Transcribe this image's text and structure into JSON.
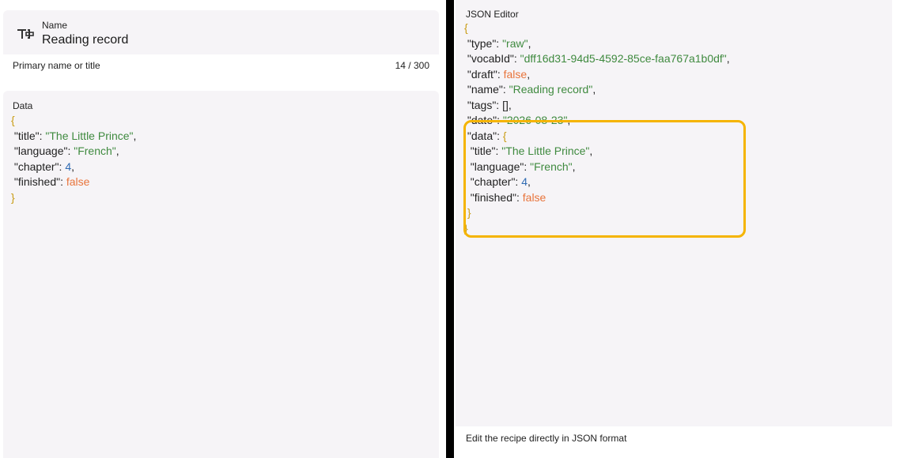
{
  "name_field": {
    "label": "Name",
    "value": "Reading record",
    "helper": "Primary name or title",
    "counter": "14 / 300"
  },
  "data_field": {
    "label": "Data",
    "open_brace": "{",
    "close_brace": "}",
    "lines": [
      {
        "key": "\"title\"",
        "value": "\"The Little Prince\"",
        "type": "str",
        "comma": ","
      },
      {
        "key": "\"language\"",
        "value": "\"French\"",
        "type": "str",
        "comma": ","
      },
      {
        "key": "\"chapter\"",
        "value": "4",
        "type": "num",
        "comma": ","
      },
      {
        "key": "\"finished\"",
        "value": "false",
        "type": "bool",
        "comma": ""
      }
    ]
  },
  "json_editor": {
    "label": "JSON Editor",
    "helper": "Edit the recipe directly in JSON format",
    "open_brace": "{",
    "close_brace": "}",
    "top_lines": [
      {
        "key": "\"type\"",
        "value": "\"raw\"",
        "type": "str",
        "comma": ","
      },
      {
        "key": "\"vocabId\"",
        "value": "\"dff16d31-94d5-4592-85ce-faa767a1b0df\"",
        "type": "str",
        "comma": ","
      },
      {
        "key": "\"draft\"",
        "value": "false",
        "type": "bool",
        "comma": ","
      },
      {
        "key": "\"name\"",
        "value": "\"Reading record\"",
        "type": "str",
        "comma": ","
      },
      {
        "key": "\"tags\"",
        "value": "[]",
        "type": "plain",
        "comma": ","
      },
      {
        "key": "\"date\"",
        "value": "\"2026-08-23\"",
        "type": "str",
        "comma": ","
      }
    ],
    "data_key": "\"data\"",
    "data_open": "{",
    "data_close": "}",
    "data_lines": [
      {
        "key": "\"title\"",
        "value": "\"The Little Prince\"",
        "type": "str",
        "comma": ","
      },
      {
        "key": "\"language\"",
        "value": "\"French\"",
        "type": "str",
        "comma": ","
      },
      {
        "key": "\"chapter\"",
        "value": "4",
        "type": "num",
        "comma": ","
      },
      {
        "key": "\"finished\"",
        "value": "false",
        "type": "bool",
        "comma": ""
      }
    ]
  },
  "colors": {
    "brace": "#c89b12",
    "string": "#3f8a3f",
    "number": "#2f6bb3",
    "boolean": "#e8743b",
    "highlight": "#f5b400",
    "field_bg": "#f6f4f7"
  },
  "icons": {
    "name_field": "text-field-icon"
  }
}
